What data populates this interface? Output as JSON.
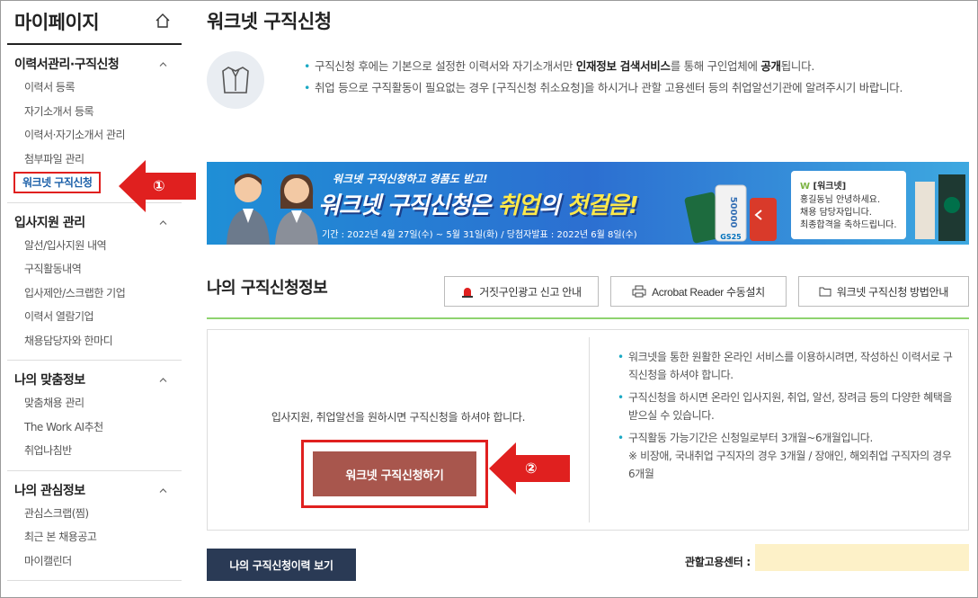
{
  "sidebar": {
    "title": "마이페이지",
    "groups": [
      {
        "title": "이력서관리·구직신청",
        "items": [
          "이력서 등록",
          "자기소개서 등록",
          "이력서·자기소개서 관리",
          "첨부파일 관리",
          "워크넷 구직신청"
        ]
      },
      {
        "title": "입사지원 관리",
        "items": [
          "알선/입사지원 내역",
          "구직활동내역",
          "입사제안/스크랩한 기업",
          "이력서 열람기업",
          "채용담당자와 한마디"
        ]
      },
      {
        "title": "나의 맞춤정보",
        "items": [
          "맞춤채용 관리",
          "The Work AI추천",
          "취업나침반"
        ]
      },
      {
        "title": "나의 관심정보",
        "items": [
          "관심스크랩(찜)",
          "최근 본 채용공고",
          "마이캘린더"
        ]
      }
    ]
  },
  "main": {
    "title": "워크넷 구직신청",
    "intro": {
      "line1_a": "구직신청 후에는 기본으로 설정한 이력서와 자기소개서만 ",
      "line1_b": "인재정보 검색서비스",
      "line1_c": "를 통해 구인업체에 ",
      "line1_d": "공개",
      "line1_e": "됩니다.",
      "line2": "취업 등으로 구직활동이 필요없는 경우 [구직신청 취소요청]을 하시거나 관할 고용센터 등의 취업알선기관에 알려주시기 바랍니다."
    },
    "banner": {
      "sub": "워크넷 구직신청하고 경품도 받고!",
      "main_a": "워크넷 구직신청은 ",
      "main_b": "취업",
      "main_c": "의 ",
      "main_d": "첫걸음!",
      "date": "기간 : 2022년 4월 27일(수) ~ 5월 31일(화) / 당첨자발표 : 2022년 6월 8일(수)",
      "card_brand": "[워크넷]",
      "card_text1": "홍길동님 안녕하세요.",
      "card_text2": "채용 담당자입니다.",
      "card_text3": "최종합격을 축하드립니다.",
      "card_value": "50000",
      "card_logo": "GS25"
    },
    "section_title": "나의 구직신청정보",
    "buttons": {
      "report": "거짓구인광고 신고 안내",
      "acrobat": "Acrobat Reader 수동설치",
      "guide": "워크넷 구직신청 방법안내"
    },
    "box": {
      "message": "입사지원, 취업알선을 원하시면 구직신청을 하셔야 합니다.",
      "apply_label": "워크넷 구직신청하기",
      "info1": "워크넷을 통한 원활한 온라인 서비스를 이용하시려면, 작성하신 이력서로 구직신청을 하셔야 합니다.",
      "info2": "구직신청을 하시면 온라인 입사지원, 취업, 알선, 장려금 등의 다양한 혜택을 받으실 수 있습니다.",
      "info3": "구직활동 가능기간은 신청일로부터 3개월~6개월입니다.",
      "info3_note": "※ 비장애, 국내취업 구직자의 경우 3개월 / 장애인, 해외취업 구직자의 경우 6개월"
    },
    "history_label": "나의 구직신청이력 보기",
    "center_label": "관할고용센터 :",
    "center_value": ""
  },
  "annotations": {
    "num1": "①",
    "num2": "②"
  },
  "colors": {
    "accent_red": "#e0201f",
    "apply_button": "#a8564d",
    "history_button": "#2a3a55",
    "green_line": "#8ed36f"
  }
}
